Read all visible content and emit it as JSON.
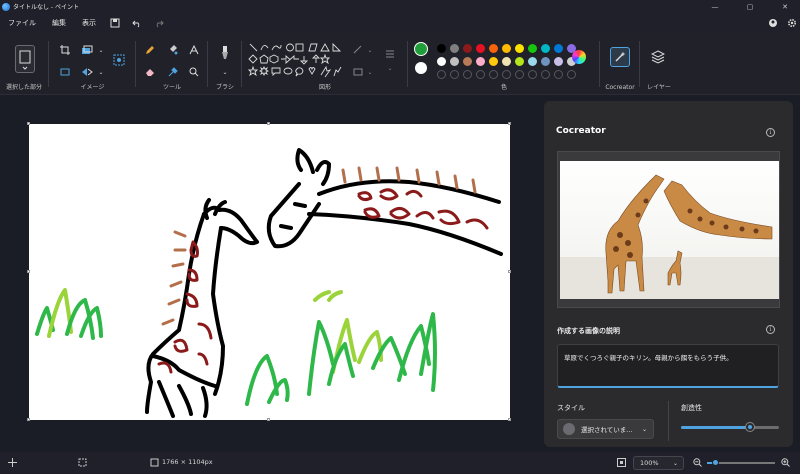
{
  "window": {
    "title": "タイトルなし - ペイント",
    "controls": [
      "—",
      "▢",
      "✕"
    ]
  },
  "menu": {
    "items": [
      "ファイル",
      "編集",
      "表示"
    ]
  },
  "ribbon": {
    "groups": {
      "selection": "選択した部分",
      "image": "イメージ",
      "tools": "ツール",
      "brush": "ブラシ",
      "shapes": "図形",
      "colors": "色",
      "cocreator": "Cocreator",
      "layers": "レイヤー"
    },
    "colors": {
      "primary": "#1f9e3a",
      "secondary": "#ffffff",
      "palette_row1": [
        "#000000",
        "#7f7f7f",
        "#8b1a1a",
        "#e81123",
        "#f7630c",
        "#ffb900",
        "#fce100",
        "#16c60c",
        "#00b7c3",
        "#0078d4",
        "#886ce4"
      ],
      "palette_row2": [
        "#ffffff",
        "#c0c0c0",
        "#b97a57",
        "#ffaec9",
        "#ffc90e",
        "#efe4b0",
        "#b5e61d",
        "#99d9ea",
        "#7092be",
        "#c8bfe7",
        "#d0d0d0"
      ]
    }
  },
  "cocreator_panel": {
    "title": "Cocreator",
    "description_label": "作成する画像の説明",
    "prompt_text": "草原でくつろぐ親子のキリン。母親から餌をもらう子供。",
    "style_label": "スタイル",
    "style_value": "選択されていま...",
    "creativity_label": "創造性",
    "creativity_level": 0.7
  },
  "status": {
    "canvas_size": "1766 × 1104px",
    "zoom_value": "100%",
    "zoom_slider_level": 0.12
  }
}
